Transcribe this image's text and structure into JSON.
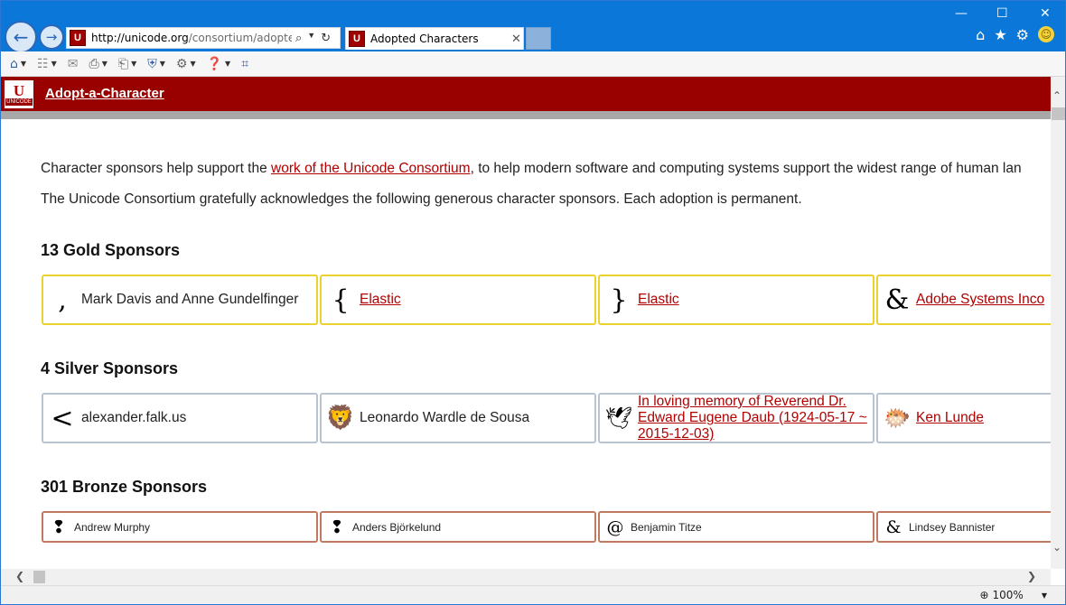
{
  "browser": {
    "url_host": "http://unicode.org",
    "url_path": "/consortium/adopted-c",
    "tab_title": "Adopted Characters",
    "tab_close": "✕",
    "back_glyph": "←",
    "forward_glyph": "→",
    "window_controls": {
      "minimize": "—",
      "maximize": "☐",
      "close": "✕"
    },
    "favicon": "U"
  },
  "banner": {
    "title": "Adopt-a-Character",
    "logo_text": "U",
    "logo_sub": "UNICODE"
  },
  "intro": {
    "line1_before": "Character sponsors help support the ",
    "line1_link": "work of the Unicode Consortium",
    "line1_after": ", to help modern software and computing systems support the widest range of human lan",
    "line2": "The Unicode Consortium gratefully acknowledges the following generous character sponsors. Each adoption is permanent."
  },
  "sections": {
    "gold_title": "13 Gold Sponsors",
    "silver_title": "4 Silver Sponsors",
    "bronze_title": "301 Bronze Sponsors"
  },
  "gold": [
    {
      "glyph": ",",
      "name": "Mark Davis and Anne Gundelfinger"
    },
    {
      "glyph": "{",
      "name": "Elastic"
    },
    {
      "glyph": "}",
      "name": "Elastic"
    },
    {
      "glyph": "&",
      "name": "Adobe Systems Inco"
    }
  ],
  "silver": [
    {
      "glyph": "<",
      "name": "alexander.falk.us"
    },
    {
      "glyph": "🦁",
      "name": "Leonardo Wardle de Sousa"
    },
    {
      "glyph": "🕊",
      "name": "In loving memory of Reverend Dr. Edward Eugene Daub (1924-05-17 ~ 2015-12-03)"
    },
    {
      "glyph": "🐡",
      "name": "Ken Lunde"
    }
  ],
  "bronze": [
    {
      "glyph": "❢",
      "name": "Andrew Murphy"
    },
    {
      "glyph": "❢",
      "name": "Anders Björkelund"
    },
    {
      "glyph": "@",
      "name": "Benjamin Titze"
    },
    {
      "glyph": "&",
      "name": "Lindsey Bannister"
    }
  ],
  "status": {
    "zoom": "100%"
  },
  "icons": {
    "home": "home-icon",
    "favorites": "star-icon",
    "settings": "gear-icon",
    "feedback": "smiley-icon",
    "refresh": "refresh-icon",
    "search": "search-icon"
  },
  "colors": {
    "banner": "#990000",
    "link": "#b00000",
    "gold": "#ecd22d",
    "silver": "#b8c4d2",
    "bronze": "#c07a62",
    "titlebar": "#0b77d8"
  }
}
